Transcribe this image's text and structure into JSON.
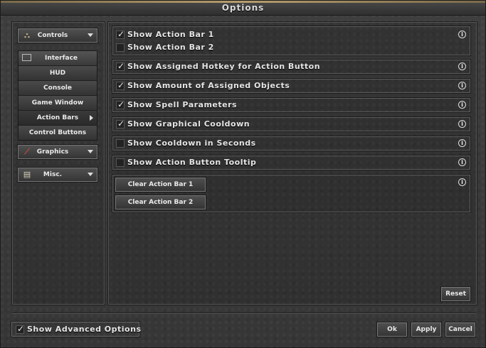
{
  "window": {
    "title": "Options"
  },
  "sidebar": {
    "controls": {
      "label": "Controls",
      "icon": "sitemap-icon"
    },
    "interface": {
      "label": "Interface",
      "icon": "window-icon",
      "items": [
        {
          "label": "HUD"
        },
        {
          "label": "Console"
        },
        {
          "label": "Game Window"
        },
        {
          "label": "Action Bars",
          "active": true
        },
        {
          "label": "Control Buttons"
        }
      ]
    },
    "graphics": {
      "label": "Graphics",
      "icon": "brush-icon"
    },
    "misc": {
      "label": "Misc.",
      "icon": "scroll-icon"
    }
  },
  "options": {
    "action_bars": [
      {
        "label": "Show Action Bar 1",
        "checked": true
      },
      {
        "label": "Show Action Bar 2",
        "checked": false
      }
    ],
    "assigned_hotkey": {
      "label": "Show Assigned Hotkey for Action Button",
      "checked": true
    },
    "assigned_objects": {
      "label": "Show Amount of Assigned Objects",
      "checked": true
    },
    "spell_parameters": {
      "label": "Show Spell Parameters",
      "checked": true
    },
    "graphical_cooldown": {
      "label": "Show Graphical Cooldown",
      "checked": true
    },
    "cooldown_seconds": {
      "label": "Show Cooldown in Seconds",
      "checked": false
    },
    "tooltip": {
      "label": "Show Action Button Tooltip",
      "checked": false
    },
    "clear_bar_1": "Clear Action Bar 1",
    "clear_bar_2": "Clear Action Bar 2",
    "info_glyph": "i"
  },
  "buttons": {
    "reset": "Reset",
    "ok": "Ok",
    "apply": "Apply",
    "cancel": "Cancel"
  },
  "footer": {
    "advanced": {
      "label": "Show Advanced Options",
      "checked": true
    }
  },
  "check_glyph": "✓"
}
